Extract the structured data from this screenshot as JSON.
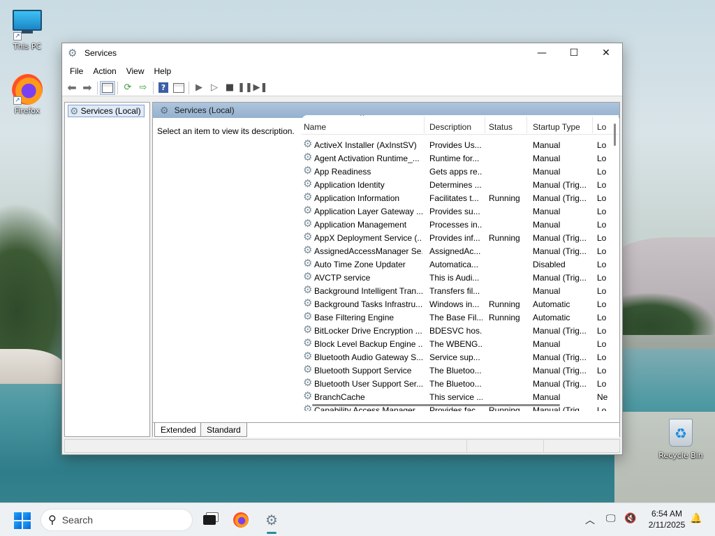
{
  "desktop": {
    "icons": [
      {
        "label": "This PC",
        "icon": "monitor-icon"
      },
      {
        "label": "Firefox",
        "icon": "firefox-icon"
      },
      {
        "label": "Recycle Bin",
        "icon": "recycle-bin-icon"
      }
    ]
  },
  "window": {
    "title": "Services",
    "controls": {
      "minimize": "—",
      "maximize": "☐",
      "close": "✕"
    },
    "menu": [
      "File",
      "Action",
      "View",
      "Help"
    ],
    "tree": {
      "root": "Services (Local)"
    },
    "pane": {
      "header": "Services (Local)",
      "description_prompt": "Select an item to view its description."
    },
    "columns": {
      "name": "Name",
      "description": "Description",
      "status": "Status",
      "startup": "Startup Type",
      "logon": "Lo"
    },
    "services": [
      {
        "name": "ActiveX Installer (AxInstSV)",
        "description": "Provides Us...",
        "status": "",
        "startup": "Manual",
        "logon": "Lo"
      },
      {
        "name": "Agent Activation Runtime_...",
        "description": "Runtime for...",
        "status": "",
        "startup": "Manual",
        "logon": "Lo"
      },
      {
        "name": "App Readiness",
        "description": "Gets apps re...",
        "status": "",
        "startup": "Manual",
        "logon": "Lo"
      },
      {
        "name": "Application Identity",
        "description": "Determines ...",
        "status": "",
        "startup": "Manual (Trig...",
        "logon": "Lo"
      },
      {
        "name": "Application Information",
        "description": "Facilitates t...",
        "status": "Running",
        "startup": "Manual (Trig...",
        "logon": "Lo"
      },
      {
        "name": "Application Layer Gateway ...",
        "description": "Provides su...",
        "status": "",
        "startup": "Manual",
        "logon": "Lo"
      },
      {
        "name": "Application Management",
        "description": "Processes in...",
        "status": "",
        "startup": "Manual",
        "logon": "Lo"
      },
      {
        "name": "AppX Deployment Service (...",
        "description": "Provides inf...",
        "status": "Running",
        "startup": "Manual (Trig...",
        "logon": "Lo"
      },
      {
        "name": "AssignedAccessManager Se...",
        "description": "AssignedAc...",
        "status": "",
        "startup": "Manual (Trig...",
        "logon": "Lo"
      },
      {
        "name": "Auto Time Zone Updater",
        "description": "Automatica...",
        "status": "",
        "startup": "Disabled",
        "logon": "Lo"
      },
      {
        "name": "AVCTP service",
        "description": "This is Audi...",
        "status": "",
        "startup": "Manual (Trig...",
        "logon": "Lo"
      },
      {
        "name": "Background Intelligent Tran...",
        "description": "Transfers fil...",
        "status": "",
        "startup": "Manual",
        "logon": "Lo"
      },
      {
        "name": "Background Tasks Infrastru...",
        "description": "Windows in...",
        "status": "Running",
        "startup": "Automatic",
        "logon": "Lo"
      },
      {
        "name": "Base Filtering Engine",
        "description": "The Base Fil...",
        "status": "Running",
        "startup": "Automatic",
        "logon": "Lo"
      },
      {
        "name": "BitLocker Drive Encryption ...",
        "description": "BDESVC hos...",
        "status": "",
        "startup": "Manual (Trig...",
        "logon": "Lo"
      },
      {
        "name": "Block Level Backup Engine ...",
        "description": "The WBENG...",
        "status": "",
        "startup": "Manual",
        "logon": "Lo"
      },
      {
        "name": "Bluetooth Audio Gateway S...",
        "description": "Service sup...",
        "status": "",
        "startup": "Manual (Trig...",
        "logon": "Lo"
      },
      {
        "name": "Bluetooth Support Service",
        "description": "The Bluetoo...",
        "status": "",
        "startup": "Manual (Trig...",
        "logon": "Lo"
      },
      {
        "name": "Bluetooth User Support Ser...",
        "description": "The Bluetoo...",
        "status": "",
        "startup": "Manual (Trig...",
        "logon": "Lo"
      },
      {
        "name": "BranchCache",
        "description": "This service ...",
        "status": "",
        "startup": "Manual",
        "logon": "Ne"
      },
      {
        "name": "Capability Access Manager ...",
        "description": "Provides fac...",
        "status": "Running",
        "startup": "Manual (Trig...",
        "logon": "Lo"
      }
    ],
    "tabs": [
      "Extended",
      "Standard"
    ]
  },
  "taskbar": {
    "search_placeholder": "Search",
    "time": "6:54 AM",
    "date": "2/11/2025"
  },
  "colors": {
    "header_blue": "#94b1cf",
    "selection_blue": "#dfeaf7",
    "accent": "#2a8c98"
  }
}
